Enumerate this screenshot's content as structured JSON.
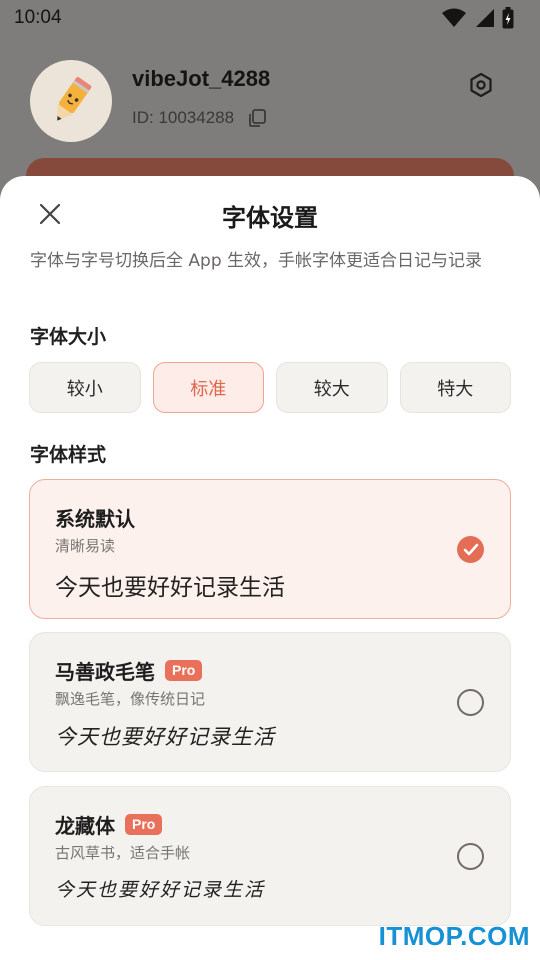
{
  "status_bar": {
    "time": "10:04"
  },
  "profile": {
    "username": "vibeJot_4288",
    "user_id": "ID: 10034288"
  },
  "sheet": {
    "title": "字体设置",
    "description": "字体与字号切换后全 App 生效，手帐字体更适合日记与记录",
    "size_section": {
      "label": "字体大小",
      "options": [
        {
          "label": "较小",
          "selected": false
        },
        {
          "label": "标准",
          "selected": true
        },
        {
          "label": "较大",
          "selected": false
        },
        {
          "label": "特大",
          "selected": false
        }
      ]
    },
    "style_section": {
      "label": "字体样式",
      "fonts": [
        {
          "name": "系统默认",
          "subtitle": "清晰易读",
          "sample": "今天也要好好记录生活",
          "badge": "",
          "selected": true
        },
        {
          "name": "马善政毛笔",
          "subtitle": "飘逸毛笔，像传统日记",
          "sample": "今天也要好好记录生活",
          "badge": "Pro",
          "selected": false
        },
        {
          "name": "龙藏体",
          "subtitle": "古风草书，适合手帐",
          "sample": "今天也要好好记录生活",
          "badge": "Pro",
          "selected": false
        }
      ]
    }
  },
  "watermark": "ITMOP.COM",
  "colors": {
    "accent": "#e46d55",
    "selected_bg": "#fdf1ed",
    "card_bg": "#f4f2ef",
    "watermark": "#1691d4"
  },
  "icons": [
    "wifi-icon",
    "signal-icon",
    "battery-icon",
    "pencil-avatar-icon",
    "settings-icon",
    "copy-icon",
    "close-icon",
    "check-icon"
  ]
}
